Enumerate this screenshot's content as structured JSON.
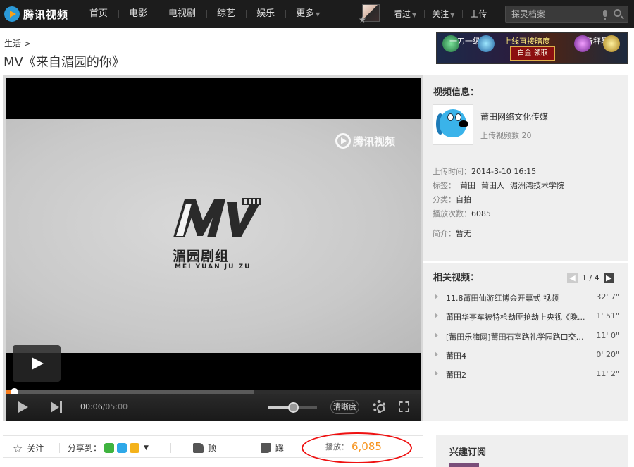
{
  "header": {
    "logo_text": "腾讯视频",
    "nav": [
      "首页",
      "电影",
      "电视剧",
      "综艺",
      "娱乐",
      "更多"
    ],
    "user_nav": [
      "看过",
      "关注",
      "上传"
    ],
    "search_placeholder": "探灵档案"
  },
  "breadcrumb": "生活 >",
  "title": "MV《来自湄园的你》",
  "banner": {
    "slogan_left": "一刀一级",
    "slogan_mid": "上线直接暗度",
    "slogan_right": "装备秤暴",
    "button": "白金  领取"
  },
  "player": {
    "watermark": "腾讯视频",
    "frame_title": "湄园剧组",
    "frame_sub": "MEI YUAN JU ZU",
    "time_current": "00:06",
    "time_total": "/05:00",
    "played_fraction": 0.02,
    "loaded_fraction": 0.6,
    "volume_fraction": 0.52,
    "quality_label": "清晰度"
  },
  "video_info": {
    "heading": "视频信息：",
    "uploader": "莆田网络文化传媒",
    "upload_count": "上传视频数  20",
    "rows": [
      {
        "label": "上传时间：",
        "value": "2014-3-10 16:15"
      },
      {
        "label": "标签：",
        "tags": [
          "莆田",
          "莆田人",
          "湄洲湾技术学院"
        ]
      },
      {
        "label": "分类：",
        "value": "自拍"
      },
      {
        "label": "播放次数：",
        "value": "6085"
      },
      {
        "label": "简介：",
        "value": "暂无"
      }
    ]
  },
  "related": {
    "heading": "相关视频：",
    "page": "1 / 4",
    "items": [
      {
        "title": "11.8莆田仙游红博会开幕式 视频",
        "duration": "32' 7\""
      },
      {
        "title": "莆田华亭车被特枪劫匪抢劫上央视《晚...",
        "duration": "1' 51\""
      },
      {
        "title": "[莆田乐嗨网]莆田石室路礼学园路口交叉...",
        "duration": "11' 0\""
      },
      {
        "title": "莆田4",
        "duration": "0' 20\""
      },
      {
        "title": "莆田2",
        "duration": "11' 2\""
      }
    ]
  },
  "actions": {
    "follow": "关注",
    "share_label": "分享到：",
    "like": "顶",
    "dislike": "踩",
    "plays_label": "播放：",
    "plays_value": "6,085"
  },
  "subscription": {
    "heading": "兴趣订阅"
  }
}
